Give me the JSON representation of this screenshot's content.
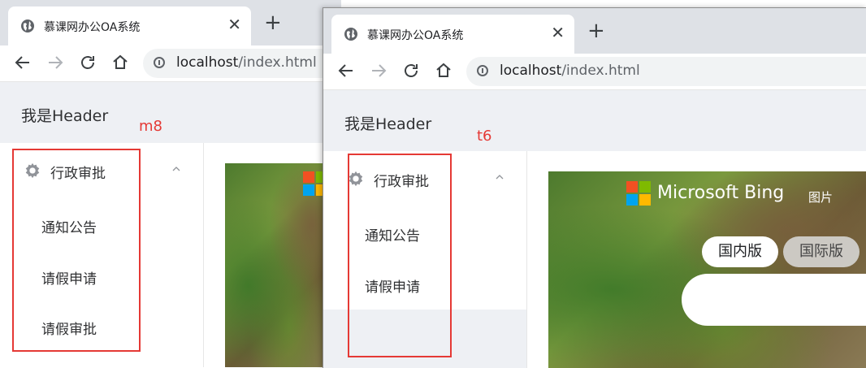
{
  "browser": {
    "tab_title": "慕课网办公OA系统",
    "close_glyph": "✕",
    "new_tab_glyph": "+",
    "url_host": "localhost",
    "url_path": "/index.html"
  },
  "page": {
    "header": "我是Header",
    "menu_title": "行政审批",
    "back_items": [
      "通知公告",
      "请假申请",
      "请假审批"
    ],
    "front_items": [
      "通知公告",
      "请假申请"
    ]
  },
  "bing": {
    "brand": "Microsoft Bing",
    "images_link": "图片",
    "tab_domestic": "国内版",
    "tab_international": "国际版"
  },
  "annotations": {
    "left": "m8",
    "right": "t6",
    "color": "#e53935"
  },
  "colors": {
    "tabstrip": "#dee1e6",
    "page_bg": "#eef0f4",
    "ms_red": "#f25022",
    "ms_green": "#7fba00",
    "ms_blue": "#00a4ef",
    "ms_yellow": "#ffb900"
  }
}
